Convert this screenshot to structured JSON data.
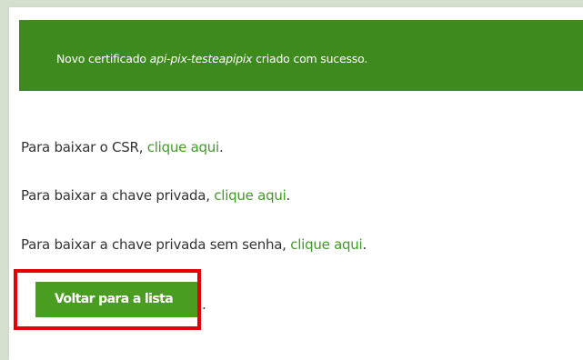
{
  "alert": {
    "prefix": "Novo certificado ",
    "certificate_name": "api-pix-testeapipix",
    "suffix": " criado com sucesso."
  },
  "downloads": [
    {
      "text": "Para baixar o CSR, ",
      "link": "clique aqui",
      "end": "."
    },
    {
      "text": "Para baixar a chave privada, ",
      "link": "clique aqui",
      "end": "."
    },
    {
      "text": "Para baixar a chave privada sem senha, ",
      "link": "clique aqui",
      "end": "."
    }
  ],
  "back": {
    "label": "Voltar para a lista",
    "trailing": "."
  },
  "colors": {
    "alert_bg": "#3f8a1f",
    "link": "#3f9c24",
    "button_bg": "#4a9d21",
    "highlight_border": "#e20000"
  }
}
